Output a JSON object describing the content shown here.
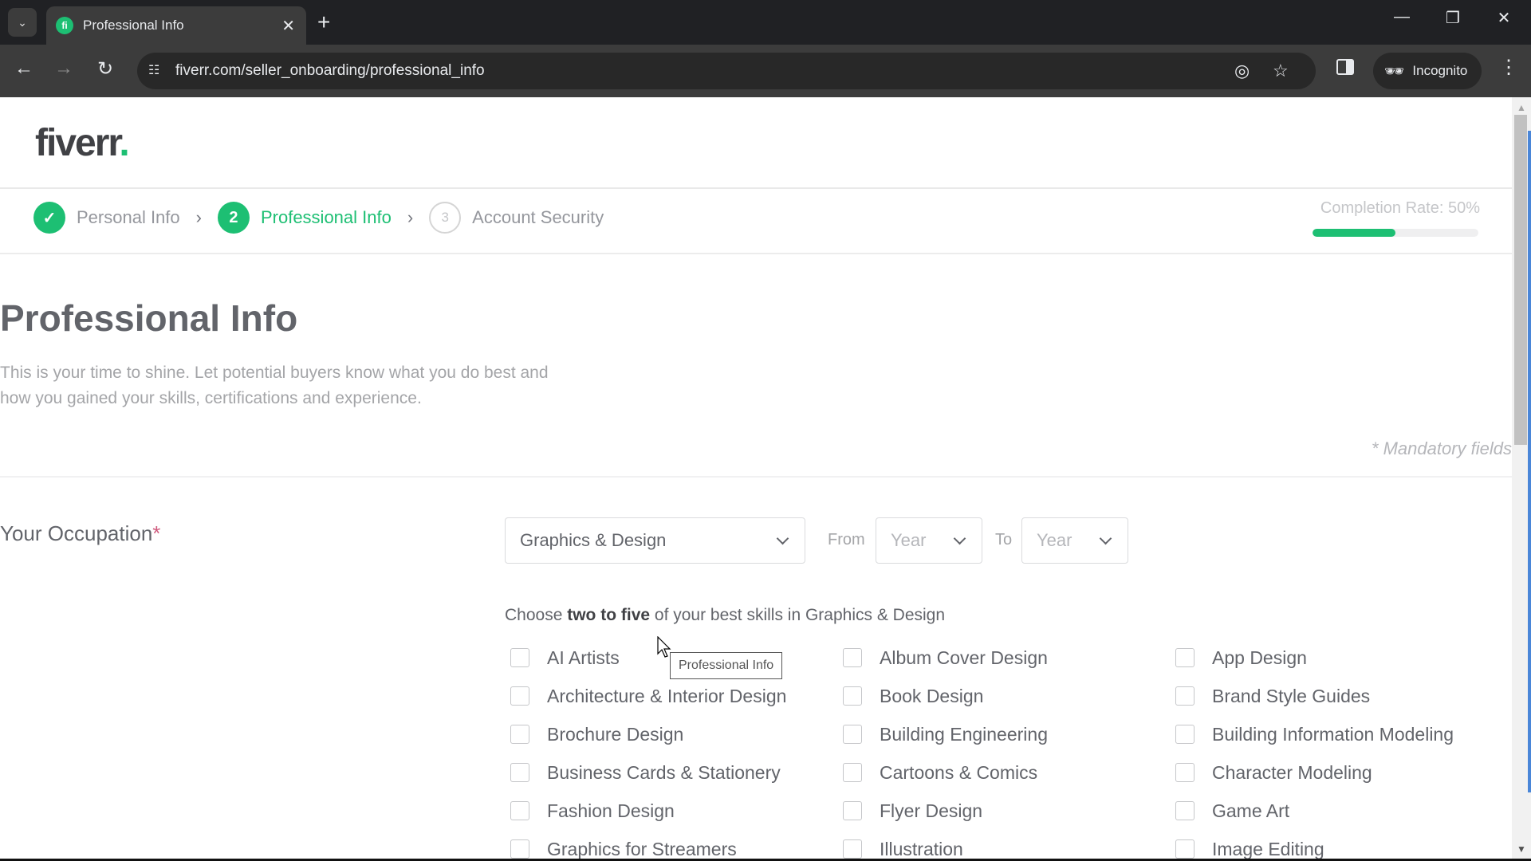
{
  "browser": {
    "tab_title": "Professional Info",
    "favicon_letter": "fi",
    "url": "fiverr.com/seller_onboarding/professional_info",
    "incognito_label": "Incognito",
    "icons": {
      "tab_search": "chevron-down-icon",
      "close_tab": "close-icon",
      "new_tab": "plus-icon",
      "back": "arrow-left-icon",
      "forward": "arrow-right-icon",
      "reload": "reload-icon",
      "site_info": "tune-icon",
      "eye_off": "eye-off-icon",
      "bookmark": "star-icon",
      "side_panel": "side-panel-icon",
      "incognito": "incognito-icon",
      "menu": "kebab-menu-icon",
      "minimize": "minimize-icon",
      "restore": "restore-icon",
      "close_window": "close-icon"
    }
  },
  "header": {
    "logo_text": "fiverr",
    "logo_dot": ".",
    "brand_color": "#1dbf73"
  },
  "stepper": {
    "steps": [
      {
        "number": "✓",
        "label": "Personal Info",
        "state": "done"
      },
      {
        "number": "2",
        "label": "Professional Info",
        "state": "active"
      },
      {
        "number": "3",
        "label": "Account Security",
        "state": "todo"
      }
    ],
    "separator": "›",
    "completion_label": "Completion Rate: 50%",
    "completion_percent": 50
  },
  "main": {
    "title": "Professional Info",
    "description": "This is your time to shine. Let potential buyers know what you do best and how you gained your skills, certifications and experience.",
    "mandatory_note": "* Mandatory fields",
    "occupation": {
      "label": "Your Occupation",
      "required_mark": "*",
      "category_value": "Graphics & Design",
      "from_label": "From",
      "from_placeholder": "Year",
      "to_label": "To",
      "to_placeholder": "Year"
    },
    "skills": {
      "heading_prefix": "Choose ",
      "heading_bold": "two to five",
      "heading_suffix": " of your best skills in Graphics & Design",
      "columns": [
        [
          "AI Artists",
          "Architecture & Interior Design",
          "Brochure Design",
          "Business Cards & Stationery",
          "Fashion Design",
          "Graphics for Streamers"
        ],
        [
          "Album Cover Design",
          "Book Design",
          "Building Engineering",
          "Cartoons & Comics",
          "Flyer Design",
          "Illustration"
        ],
        [
          "App Design",
          "Brand Style Guides",
          "Building Information Modeling",
          "Character Modeling",
          "Game Art",
          "Image Editing"
        ]
      ]
    },
    "tooltip": "Professional Info"
  }
}
